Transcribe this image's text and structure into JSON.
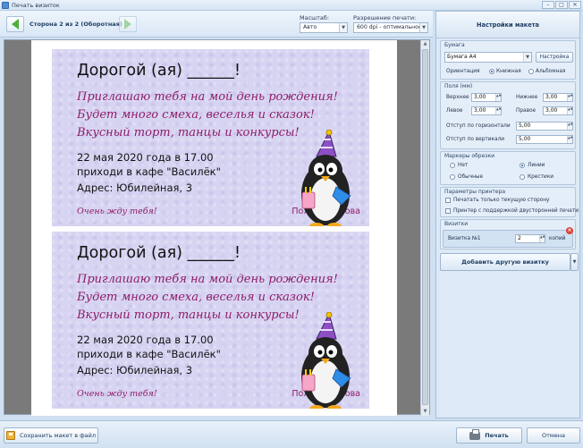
{
  "window": {
    "title": "Печать визиток"
  },
  "toolbar": {
    "page_indicator": "Сторона 2 из 2 (Оборотная)",
    "scale_label": "Масштаб:",
    "scale_value": "Авто",
    "resolution_label": "Разрешение печати:",
    "resolution_value": "600 dpi - оптимальное"
  },
  "card": {
    "greeting": "Дорогой (ая) ______!",
    "invitation_lines": [
      "Приглашаю тебя на мой день рождения!",
      "Будет много смеха, веселья и сказок!",
      "Вкусный торт, танцы и конкурсы!"
    ],
    "date_line": "22 мая 2020 года в 17.00",
    "place_line": "приходи в кафе \"Василёк\"",
    "address_line": "Адрес: Юбилейная, 3",
    "closing": "Очень жду тебя!",
    "signature": "Полина Ионова",
    "colors": {
      "background": "#d7d4f2",
      "accent_text": "#8e1c68"
    }
  },
  "settings": {
    "header": "Настройки макета",
    "paper": {
      "title": "Бумага",
      "paper_value": "Бумага А4",
      "setup_button": "Настройка",
      "orientation_label": "Ориентация",
      "portrait": "Книжная",
      "landscape": "Альбомная",
      "selected": "portrait"
    },
    "margins": {
      "title": "Поля (мм)",
      "top_label": "Верхнее",
      "top_value": "3,00",
      "bottom_label": "Нижнее",
      "bottom_value": "3,00",
      "left_label": "Левое",
      "left_value": "3,00",
      "right_label": "Правое",
      "right_value": "3,00",
      "h_offset_label": "Отступ по горизонтали",
      "h_offset_value": "5,00",
      "v_offset_label": "Отступ по вертикали",
      "v_offset_value": "5,00"
    },
    "crop_marks": {
      "title": "Маркеры обрезки",
      "none": "Нет",
      "lines": "Линии",
      "normal": "Обычные",
      "crosses": "Крестики",
      "selected": "lines"
    },
    "printer": {
      "title": "Параметры принтера",
      "current_side_only": "Печатать только текущую сторону",
      "duplex": "Принтер с поддержкой двусторонней печати"
    },
    "cards": {
      "title": "Визитки",
      "item_label": "Визитка №1",
      "copies_value": "2",
      "copies_label": "копий"
    },
    "add_button": "Добавить другую визитку"
  },
  "bottom": {
    "save_layout": "Сохранить макет в файл",
    "print": "Печать",
    "cancel": "Отмена"
  }
}
